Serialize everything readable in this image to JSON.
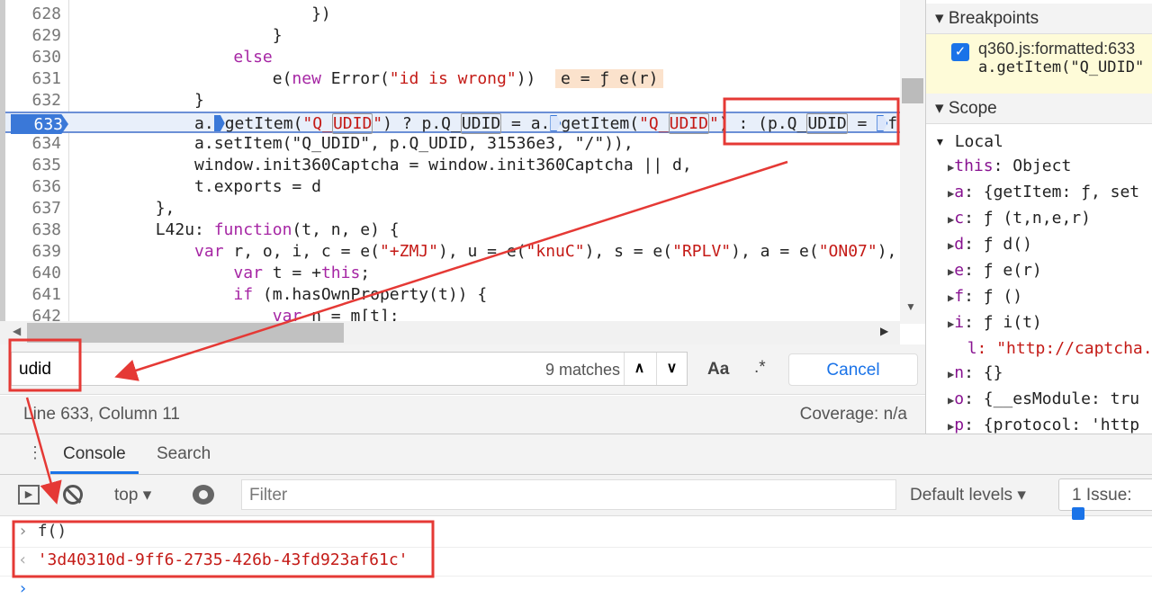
{
  "editor": {
    "lines": [
      {
        "n": "628",
        "t": "                        })"
      },
      {
        "n": "629",
        "t": "                    }"
      },
      {
        "n": "630",
        "t": "                else"
      },
      {
        "n": "631",
        "t": "                    e(new Error(\"id is wrong\"))",
        "inline": "e = ƒ e(r)"
      },
      {
        "n": "632",
        "t": "            }"
      },
      {
        "n": "633",
        "t": "current"
      },
      {
        "n": "634",
        "t": "            a.setItem(\"Q_UDID\", p.Q_UDID, 31536e3, \"/\")),"
      },
      {
        "n": "635",
        "t": "            window.init360Captcha = window.init360Captcha || d,"
      },
      {
        "n": "636",
        "t": "            t.exports = d"
      },
      {
        "n": "637",
        "t": "        },"
      },
      {
        "n": "638",
        "t": "        L42u: function(t, n, e) {"
      },
      {
        "n": "639",
        "t": "            var r, o, i, c = e(\"+ZMJ\"), u = e(\"knuC\"), s = e(\"RPLV\"), a = e(\"ON07\"), f"
      },
      {
        "n": "640",
        "t": "                var t = +this;"
      },
      {
        "n": "641",
        "t": "                if (m.hasOwnProperty(t)) {"
      },
      {
        "n": "642",
        "t": "                    var n = m[t];"
      }
    ]
  },
  "search": {
    "value": "udid",
    "matches": "9 matches",
    "case_label": "Aa",
    "regex_label": ".*",
    "cancel_label": "Cancel"
  },
  "status": {
    "position": "Line 633, Column 11",
    "coverage": "Coverage: n/a"
  },
  "right": {
    "breakpoints_title": "Breakpoints",
    "bp_file": "q360.js:formatted:633",
    "bp_code": "a.getItem(\"Q_UDID\"",
    "scope_title": "Scope",
    "local_title": "Local",
    "scope": [
      {
        "k": "this",
        "v": ": Object",
        "exp": true
      },
      {
        "k": "a",
        "v": ": {getItem: ƒ, set",
        "exp": true
      },
      {
        "k": "c",
        "v": ": ƒ (t,n,e,r)",
        "exp": true
      },
      {
        "k": "d",
        "v": ": ƒ d()",
        "exp": true
      },
      {
        "k": "e",
        "v": ": ƒ e(r)",
        "exp": true
      },
      {
        "k": "f",
        "v": ": ƒ ()",
        "exp": true
      },
      {
        "k": "i",
        "v": ": ƒ i(t)",
        "exp": true
      },
      {
        "k": "l",
        "v": ": \"http://captcha.",
        "exp": false
      },
      {
        "k": "n",
        "v": ": {}",
        "exp": true
      },
      {
        "k": "o",
        "v": ": {__esModule: tru",
        "exp": true
      },
      {
        "k": "p",
        "v": ": {protocol: 'http",
        "exp": true
      }
    ]
  },
  "tabs": [
    {
      "label": "Console",
      "active": true
    },
    {
      "label": "Search",
      "active": false
    }
  ],
  "console": {
    "context": "top",
    "filter_placeholder": "Filter",
    "levels": "Default levels",
    "issues": "1 Issue:",
    "input": "f()",
    "result": "'3d40310d-9ff6-2735-426b-43fd923af61c'"
  },
  "colors": {
    "annotation": "#e53935",
    "accent": "#1a73e8"
  }
}
